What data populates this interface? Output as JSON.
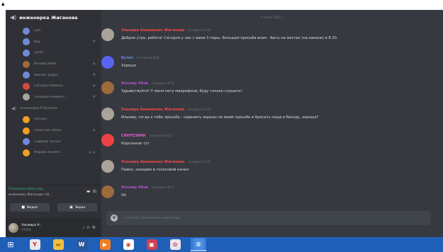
{
  "voice_channel": {
    "name": "инженерка Жиганова"
  },
  "members": [
    {
      "name": "Ерм",
      "color": "#7289da",
      "icon": ""
    },
    {
      "name": "Кир",
      "color": "#7289da",
      "icon": "#"
    },
    {
      "name": "Булат",
      "color": "#7289da",
      "icon": ""
    },
    {
      "name": "Ильмир Абай",
      "color": "#9c6a3b",
      "icon": "#"
    },
    {
      "name": "Михаил Ерден",
      "color": "#7289da",
      "icon": "#"
    },
    {
      "name": "Сагорра Рафаэль",
      "color": "#d14a3b",
      "icon": "#"
    },
    {
      "name": "Эльмира Аниманс...",
      "color": "#a9a39b",
      "icon": "#"
    }
  ],
  "voice_channel_2": {
    "name": "инженерка Р.Кутьева"
  },
  "members2": [
    {
      "name": "Уменых",
      "color": "#f0a020",
      "icon": ""
    },
    {
      "name": "Нарыгнин Абаш",
      "color": "#f0a020",
      "icon": "#"
    },
    {
      "name": "Сидоров Руслан",
      "color": "#7289da",
      "icon": ""
    },
    {
      "name": "Форрер Каниет...",
      "color": "#f0a020",
      "icon": "# ⊖"
    }
  ],
  "connection": {
    "status": "Голосовая связь под...",
    "channel": "инженерка Жиганова / Ш..."
  },
  "buttons": {
    "video": "Видео",
    "screen": "Экран"
  },
  "user": {
    "name": "Эльмира А...",
    "tag": "#7410"
  },
  "date_divider": "4 марта 2021 г.",
  "messages": [
    {
      "author": "Эльмира Аниманова Жиганова",
      "time": "Сегодня в 8:28",
      "text": "Доброе утро, ребята! Сегодня у нас с вами 3 пары. Большая просьба всем - быть на местах (на канале) в 8.30.",
      "color": "#f04747",
      "avatar": "#a9a39b"
    },
    {
      "author": "Булат",
      "time": "Сегодня в 8:29",
      "text": "Хорошо",
      "color": "#7289da",
      "avatar": "#5865f2"
    },
    {
      "author": "Ильмир Абай",
      "time": "Сегодня в 8:30",
      "text": "Здравствуйте! У меня нету микрофона, буду только слушать!",
      "color": "#b04fd0",
      "avatar": "#9c6a3b"
    },
    {
      "author": "Эльмира Аниманова Жиганова",
      "time": "Сегодня в 8:32",
      "text": "Ильмир, тогда к тебе просьба - скринить экраны по моей просьбе и бросать сюда в беседу, хорошо?",
      "color": "#f04747",
      "avatar": "#a9a39b"
    },
    {
      "author": "СИНТЕЗИНК",
      "time": "Сегодня в 8:33",
      "text": "Корольков тут",
      "color": "#e05cd0",
      "avatar": "#ed4245"
    },
    {
      "author": "Эльмира Аниманова Жиганова",
      "time": "Сегодня в 8:34",
      "text": "Павел, заходим в голосовой канал",
      "color": "#f04747",
      "avatar": "#a9a39b"
    },
    {
      "author": "Ильмир Абай",
      "time": "Сегодня в 8:37",
      "text": "Ок",
      "color": "#b04fd0",
      "avatar": "#9c6a3b"
    }
  ],
  "input": {
    "placeholder": "Написать #инженерка-жиганова"
  },
  "taskbar": [
    {
      "icon": "yandex-browser-icon",
      "glyph": "Y",
      "color": "#e8e8e8",
      "fg": "#e02020"
    },
    {
      "icon": "folder-icon",
      "glyph": "▬",
      "color": "#f0c040",
      "fg": "#b08010"
    },
    {
      "icon": "word-icon",
      "glyph": "W",
      "color": "#2b579a",
      "fg": "#ffffff"
    },
    {
      "icon": "media-player-icon",
      "glyph": "▶",
      "color": "#f08020",
      "fg": "#ffffff"
    },
    {
      "icon": "chrome-icon",
      "glyph": "◉",
      "color": "#ffffff",
      "fg": "#db4437"
    },
    {
      "icon": "screen-capture-icon",
      "glyph": "▣",
      "color": "#d04050",
      "fg": "#ffffff"
    },
    {
      "icon": "paint-icon",
      "glyph": "✿",
      "color": "#e8e8e8",
      "fg": "#d04080"
    },
    {
      "icon": "discord-icon",
      "glyph": "◍",
      "color": "#4a90e2",
      "fg": "#ffffff"
    }
  ]
}
